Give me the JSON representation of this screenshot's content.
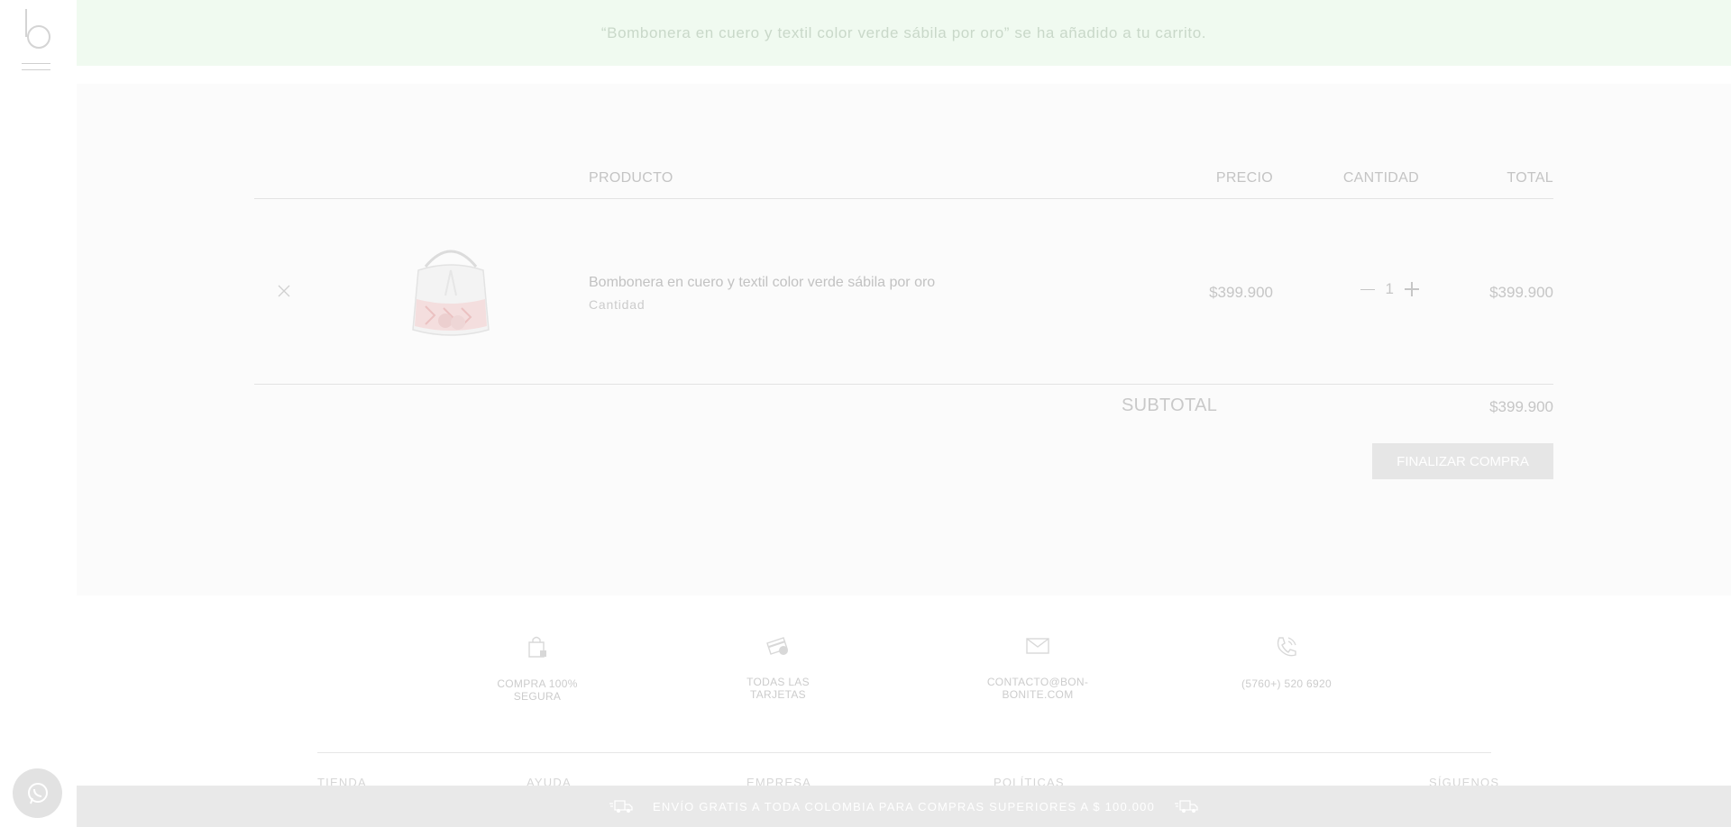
{
  "notice": {
    "message": "“Bombonera en cuero y textil color verde sábila por oro” se ha añadido a tu carrito."
  },
  "cart": {
    "headers": {
      "product": "PRODUCTO",
      "price": "PRECIO",
      "quantity": "CANTIDAD",
      "total": "TOTAL"
    },
    "items": [
      {
        "name": "Bombonera en cuero y textil color verde sábila por oro",
        "meta": "Cantidad",
        "price": "$399.900",
        "quantity": "1",
        "total": "$399.900",
        "image_icon": "handbag-product-image"
      }
    ],
    "subtotal_label": "SUBTOTAL",
    "subtotal_value": "$399.900",
    "checkout_label": "FINALIZAR COMPRA"
  },
  "trust": [
    {
      "label": "COMPRA 100% SEGURA",
      "icon": "secure-bag-icon"
    },
    {
      "label": "TODAS LAS TARJETAS",
      "icon": "card-icon"
    },
    {
      "label": "CONTACTO@BON-BONITE.COM",
      "icon": "mail-icon"
    },
    {
      "label": "(5760+) 520 6920",
      "icon": "phone-icon"
    }
  ],
  "footer": {
    "columns": [
      "TIENDA",
      "AYUDA",
      "EMPRESA",
      "POLÍTICAS",
      "SÍGUENOS"
    ]
  },
  "promo": {
    "text": "ENVÍO GRATIS A TODA COLOMBIA PARA COMPRAS SUPERIORES A $ 100.000",
    "icon": "delivery-truck-icon"
  },
  "colors": {
    "notice_bg": "#f0faf0",
    "panel_bg": "#fbfbfb",
    "promo_bg": "#e9e9e9",
    "button_bg": "#e6e6e6"
  }
}
